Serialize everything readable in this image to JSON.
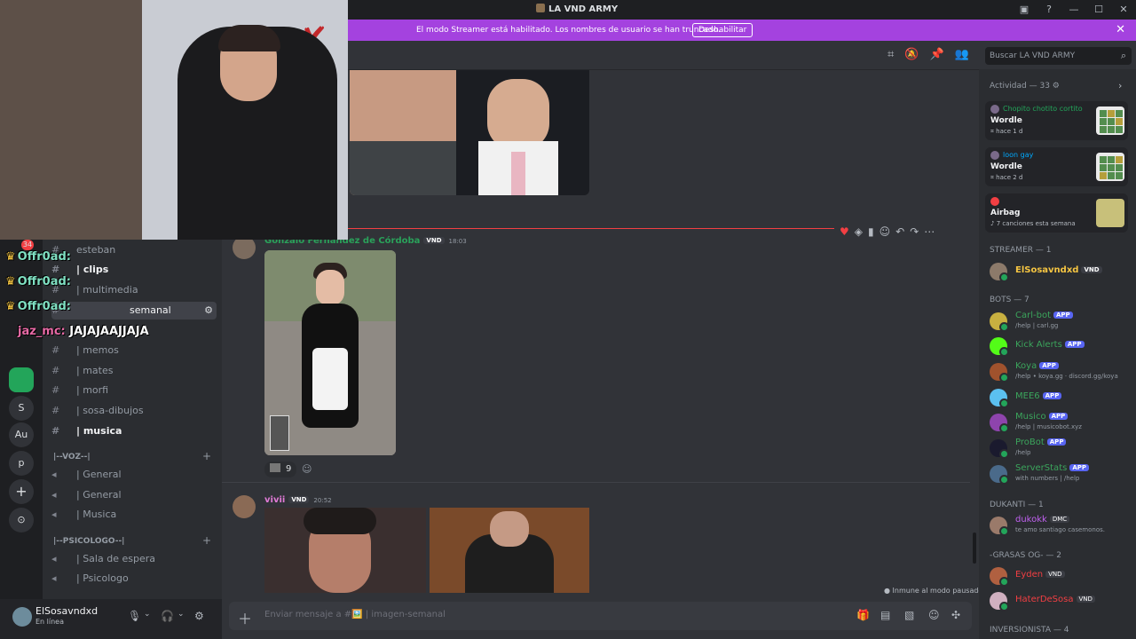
{
  "window": {
    "title": "LA VND ARMY",
    "controls": [
      "—",
      "☐",
      "✕"
    ]
  },
  "banner": {
    "text": "El modo Streamer está habilitado. Los nombres de usuario se han truncado.",
    "button": "Deshabilitar"
  },
  "search": {
    "placeholder": "Buscar LA VND ARMY"
  },
  "guilds": {
    "badge": "34",
    "items": [
      "S",
      "Au",
      "p"
    ]
  },
  "overlay_chat": [
    {
      "user": "Offr0ad:",
      "message": ""
    },
    {
      "user": "Offr0ad:",
      "message": ""
    },
    {
      "user": "Offr0ad:",
      "message": ""
    },
    {
      "user": "jaz_mc:",
      "message": "JAJAJAAJJAJA"
    }
  ],
  "channels": {
    "items": [
      {
        "label": "esteban"
      },
      {
        "label": "| clips"
      },
      {
        "label": "| multimedia"
      },
      {
        "label": "semanal"
      },
      {
        "label": "| memos"
      },
      {
        "label": "| mates"
      },
      {
        "label": "| morfi"
      },
      {
        "label": "| sosa-dibujos"
      },
      {
        "label": "| musica"
      }
    ],
    "voice_category_1": "|--VOZ--|",
    "voice_1": [
      "| General",
      "| General",
      "| Musica"
    ],
    "voice_category_2": "|--PSICOLOGO--|",
    "voice_2": [
      "| Sala de espera",
      "| Psicologo"
    ]
  },
  "user": {
    "name": "ElSosavndxd",
    "status": "En línea"
  },
  "messages": [
    {
      "author": "Gonzalo Fernández de Córdoba",
      "tag": "VND",
      "time": "18:03",
      "reaction_count": "9"
    },
    {
      "author": "vivii",
      "tag": "VND",
      "time": "20:52"
    }
  ],
  "pause_info": "Inmune al modo pausado",
  "composer": {
    "placeholder": "Enviar mensaje a #🖼️ | imagen-semanal"
  },
  "activity": {
    "header": "Actividad — 33",
    "cards": [
      {
        "user": "Chopito chotito cortito",
        "game": "Wordle",
        "sub": "hace 1 d"
      },
      {
        "user": "loon gay",
        "game": "Wordle",
        "sub": "hace 2 d"
      },
      {
        "user": "",
        "game": "Airbag",
        "sub": "7 canciones esta semana"
      }
    ]
  },
  "member_sections": [
    {
      "title": "STREAMER — 1"
    },
    {
      "title": "BOTS — 7"
    },
    {
      "title": "DUKANTI — 1"
    },
    {
      "title": "-GRASAS OG- — 2"
    },
    {
      "title": "INVERSIONISTA — 4"
    }
  ],
  "members": {
    "streamer": [
      {
        "name": "ElSosavndxd",
        "color": "#f5c542",
        "tag": "VND"
      }
    ],
    "bots": [
      {
        "name": "Carl-bot",
        "status": "/help | carl.gg",
        "color": "#3ba55c"
      },
      {
        "name": "Kick Alerts",
        "status": "",
        "color": "#3ba55c"
      },
      {
        "name": "Koya",
        "status": "/help • koya.gg · discord.gg/koya",
        "color": "#3ba55c"
      },
      {
        "name": "MEE6",
        "status": "",
        "color": "#3ba55c"
      },
      {
        "name": "Musico",
        "status": "/help | musicobot.xyz",
        "color": "#3ba55c"
      },
      {
        "name": "ProBot",
        "status": "/help",
        "color": "#3ba55c"
      },
      {
        "name": "ServerStats",
        "status": "with numbers | /help",
        "color": "#3ba55c"
      }
    ],
    "app_label": "APP",
    "dukanti": [
      {
        "name": "dukokk",
        "status": "te amo santiago casemonos.",
        "color": "#c061f0",
        "tag": "DMC"
      }
    ],
    "grasas": [
      {
        "name": "Eyden",
        "color": "#f23f43",
        "tag": "VND"
      },
      {
        "name": "HaterDeSosa",
        "color": "#f23f43",
        "tag": "VND"
      }
    ]
  },
  "colors": {
    "banner": "#a442df",
    "background": "#313338",
    "online": "#23a55a",
    "app_badge": "#5865f2"
  }
}
